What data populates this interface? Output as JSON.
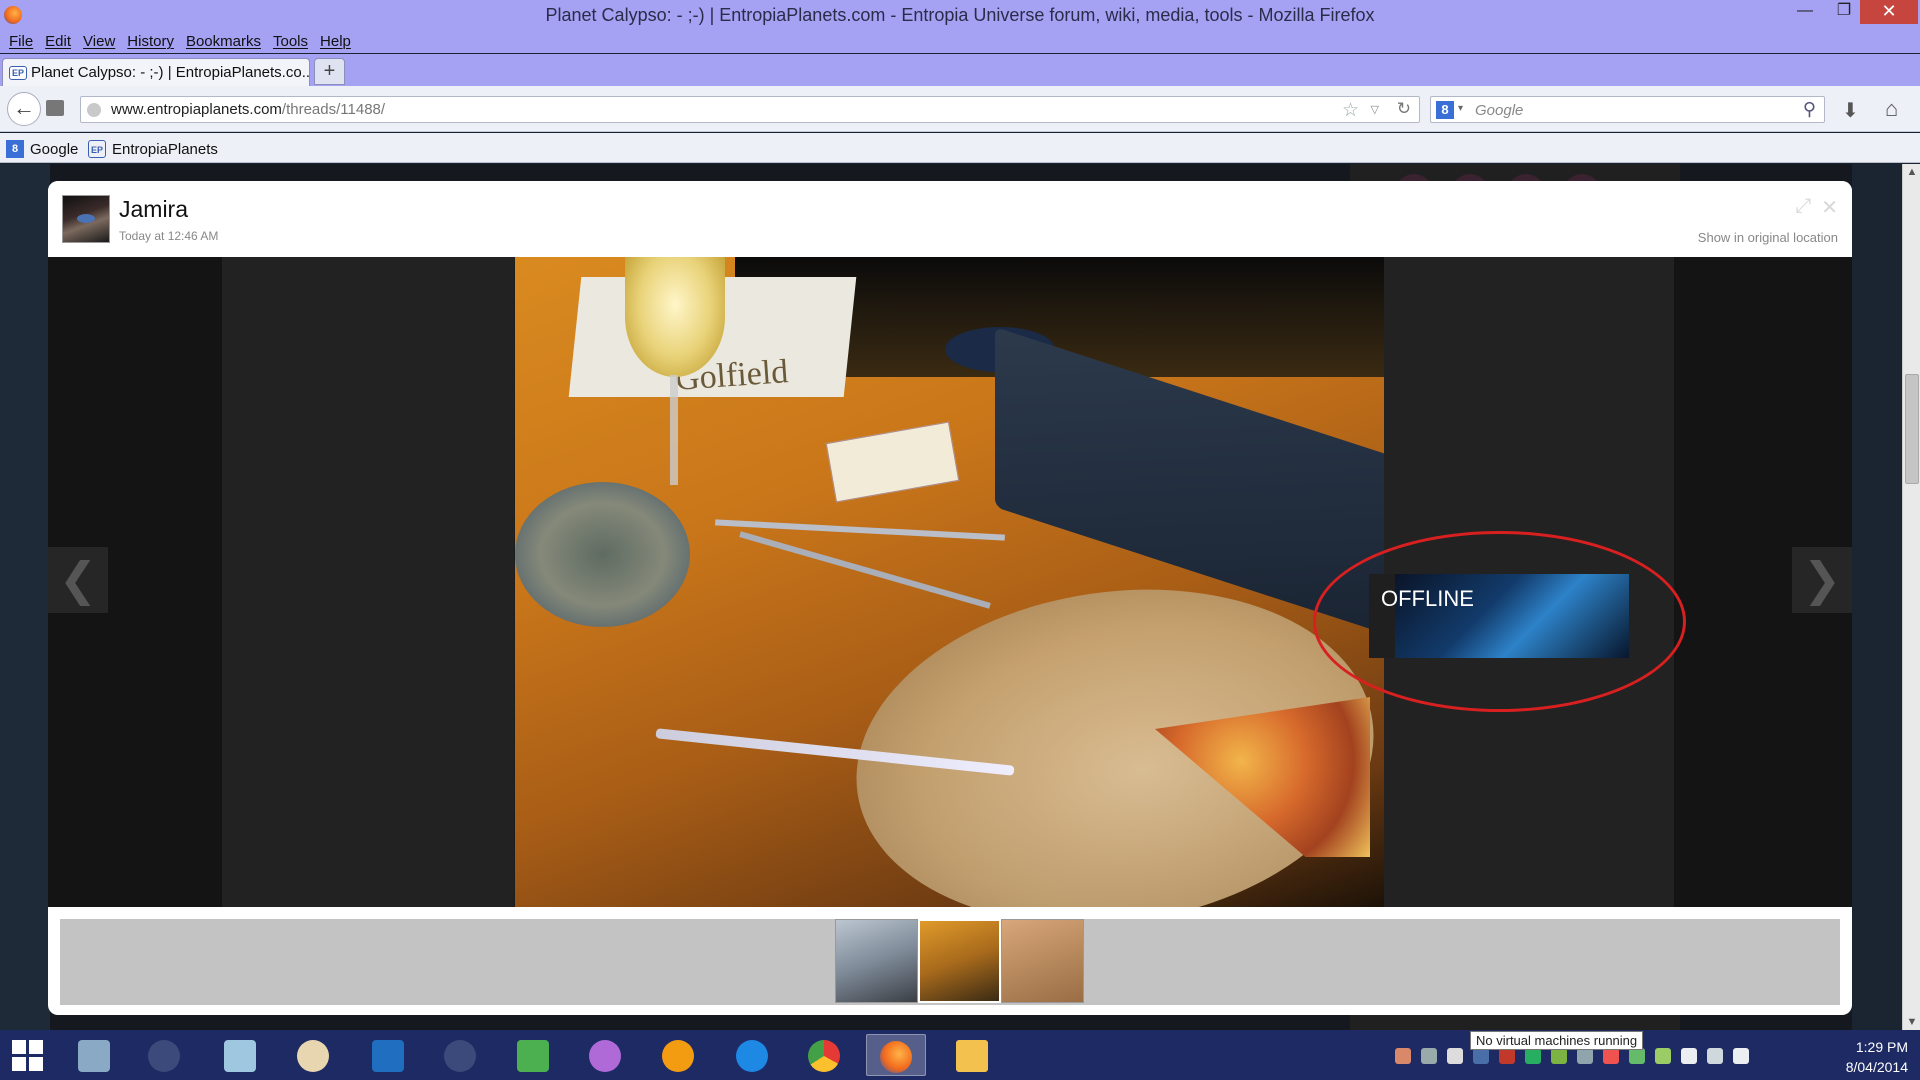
{
  "window": {
    "title": "Planet Calypso: - ;-) | EntropiaPlanets.com - Entropia Universe forum, wiki, media, tools - Mozilla Firefox",
    "minimize": "—",
    "maximize": "❐",
    "close": "✕"
  },
  "menu": [
    "File",
    "Edit",
    "View",
    "History",
    "Bookmarks",
    "Tools",
    "Help"
  ],
  "tab": {
    "favicon": "EP",
    "label": "Planet Calypso: - ;-) | EntropiaPlanets.co...",
    "new_tab": "+"
  },
  "nav": {
    "back": "←",
    "url_host": "www.entropiaplanets.com",
    "url_path": "/threads/11488/",
    "star": "☆",
    "drop": "▽",
    "reload": "↻",
    "search_engine": "8",
    "search_drop": "▾",
    "search_placeholder": "Google",
    "search_icon": "⚲",
    "download": "⬇",
    "home": "⌂"
  },
  "bookmarks": [
    {
      "icon": "8",
      "label": "Google"
    },
    {
      "icon": "EP",
      "label": "EntropiaPlanets"
    }
  ],
  "lightbox": {
    "username": "Jamira",
    "time": "Today at 12:46 AM",
    "show_original": "Show in original location",
    "prev_arrow": "❮",
    "next_arrow": "❯",
    "photo_text": "Golfield",
    "offline_label": "OFFLINE"
  },
  "taskbar": {
    "tooltip": "No virtual machines running",
    "time": "1:29 PM",
    "date": "8/04/2014",
    "apps": [
      "windows-explorer",
      "steam",
      "notepad",
      "paint",
      "outlook",
      "steam-2",
      "apps",
      "teacup",
      "brave",
      "internet-explorer",
      "chrome",
      "firefox",
      "file-explorer"
    ]
  },
  "colors": {
    "titlebar": "#a6a2f3",
    "ring": "#d7201f",
    "taskbar": "#1d2a63"
  }
}
